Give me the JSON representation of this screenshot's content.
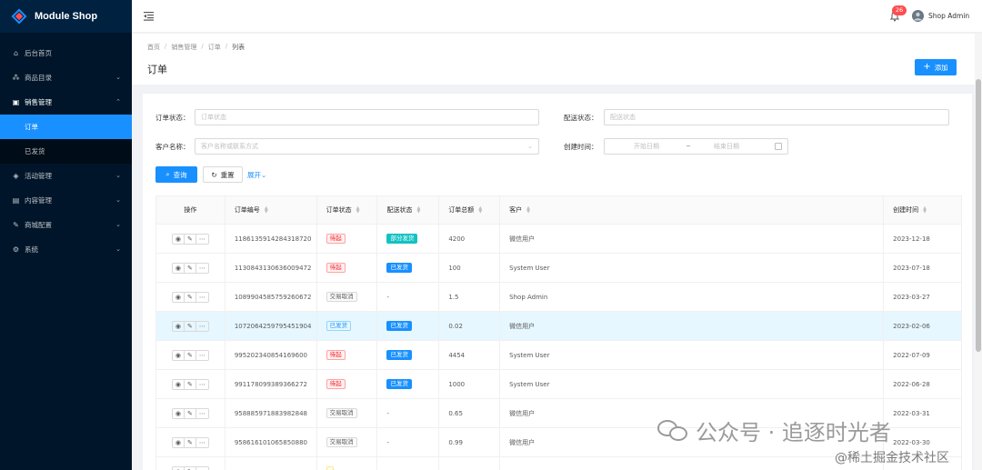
{
  "app": {
    "name": "Module Shop"
  },
  "sidebar": {
    "items": [
      {
        "label": "后台首页",
        "icon": "home-icon",
        "has_arrow": false
      },
      {
        "label": "商品目录",
        "icon": "catalog-icon",
        "has_arrow": true
      },
      {
        "label": "销售管理",
        "icon": "sales-icon",
        "has_arrow": true,
        "open": true
      },
      {
        "label": "活动管理",
        "icon": "activity-icon",
        "has_arrow": true
      },
      {
        "label": "内容管理",
        "icon": "content-icon",
        "has_arrow": true
      },
      {
        "label": "商城配置",
        "icon": "config-icon",
        "has_arrow": true
      },
      {
        "label": "系统",
        "icon": "system-icon",
        "has_arrow": true
      }
    ],
    "sub_items": [
      {
        "label": "订单",
        "active": true
      },
      {
        "label": "已发货",
        "active": false
      }
    ]
  },
  "header": {
    "notification_count": "26",
    "username": "Shop Admin"
  },
  "breadcrumb": [
    "首页",
    "销售管理",
    "订单",
    "列表"
  ],
  "page": {
    "title": "订单",
    "add_label": "添加"
  },
  "filters": {
    "order_status_label": "订单状态：",
    "order_status_placeholder": "订单状态",
    "delivery_status_label": "配送状态：",
    "delivery_status_placeholder": "配送状态",
    "customer_label": "客户名称：",
    "customer_placeholder": "客户名称或联系方式",
    "created_label": "创建时间：",
    "start_placeholder": "开始日期",
    "range_sep": "~",
    "end_placeholder": "结束日期",
    "query_label": "查询",
    "reset_label": "重置",
    "expand_label": "展开"
  },
  "table": {
    "headers": [
      "操作",
      "订单编号",
      "订单状态",
      "配送状态",
      "订单总额",
      "客户",
      "创建时间"
    ],
    "rows": [
      {
        "id": "1186135914284318720",
        "status": "待起",
        "status_style": "tag-red",
        "delivery": "部分发货",
        "delivery_style": "tag-solid-cyan",
        "amount": "4200",
        "customer": "微信用户",
        "created": "2023-12-18"
      },
      {
        "id": "1130843130636009472",
        "status": "待起",
        "status_style": "tag-red",
        "delivery": "已发货",
        "delivery_style": "tag-solid-blue",
        "amount": "100",
        "customer": "System User",
        "created": "2023-07-18"
      },
      {
        "id": "1089904585759260672",
        "status": "交易取消",
        "status_style": "tag-default",
        "delivery": "-",
        "delivery_style": "",
        "amount": "1.5",
        "customer": "Shop Admin",
        "created": "2023-03-27"
      },
      {
        "id": "1072064259795451904",
        "status": "已发货",
        "status_style": "tag-blue-outline",
        "delivery": "已发货",
        "delivery_style": "tag-solid-blue",
        "amount": "0.02",
        "customer": "微信用户",
        "created": "2023-02-06",
        "highlight": true
      },
      {
        "id": "995202340854169600",
        "status": "待起",
        "status_style": "tag-red",
        "delivery": "已发货",
        "delivery_style": "tag-solid-blue",
        "amount": "4454",
        "customer": "System User",
        "created": "2022-07-09"
      },
      {
        "id": "991178099389366272",
        "status": "待起",
        "status_style": "tag-red",
        "delivery": "已发货",
        "delivery_style": "tag-solid-blue",
        "amount": "1000",
        "customer": "System User",
        "created": "2022-06-28"
      },
      {
        "id": "958885971883982848",
        "status": "交易取消",
        "status_style": "tag-default",
        "delivery": "-",
        "delivery_style": "",
        "amount": "0.65",
        "customer": "微信用户",
        "created": "2022-03-31"
      },
      {
        "id": "958616101065850880",
        "status": "交易取消",
        "status_style": "tag-default",
        "delivery": "-",
        "delivery_style": "",
        "amount": "0.99",
        "customer": "微信用户",
        "created": "2022-03-30"
      },
      {
        "id": "",
        "status": "",
        "status_style": "tag-yellow",
        "delivery": "",
        "delivery_style": "",
        "amount": "",
        "customer": "",
        "created": ""
      }
    ]
  },
  "watermark": {
    "text1": "公众号 · 追逐时光者",
    "text2": "@稀土掘金技术社区"
  },
  "colors": {
    "primary": "#1890ff",
    "sidebar_bg": "#001529",
    "danger": "#ff4d4f"
  }
}
